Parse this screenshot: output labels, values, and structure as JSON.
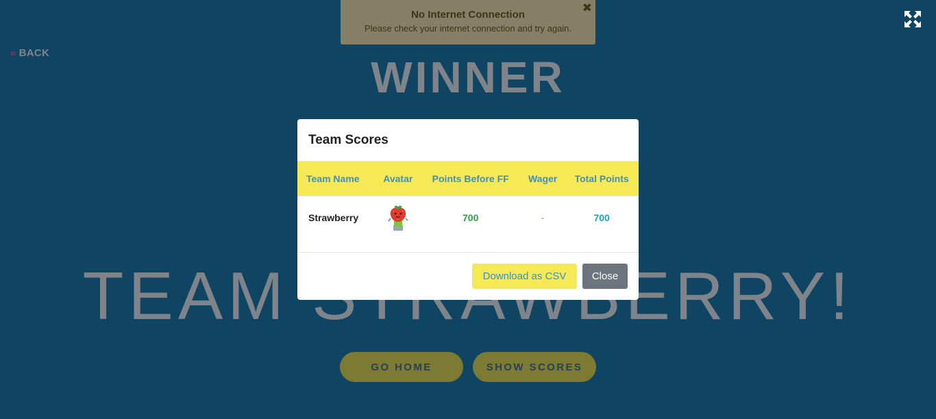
{
  "nav": {
    "back_label": "BACK"
  },
  "page": {
    "winner_heading": "WINNER",
    "team_heading": "TEAM STRAWBERRY!",
    "go_home_label": "GO HOME",
    "show_scores_label": "SHOW SCORES"
  },
  "toast": {
    "title": "No Internet Connection",
    "message": "Please check your internet connection and try again.",
    "close_glyph": "✖"
  },
  "modal": {
    "title": "Team Scores",
    "columns": [
      "Team Name",
      "Avatar",
      "Points Before FF",
      "Wager",
      "Total Points"
    ],
    "rows": [
      {
        "team_name": "Strawberry",
        "avatar": "strawberry-avatar-icon",
        "points_before_ff": "700",
        "wager": "-",
        "total_points": "700"
      }
    ],
    "download_label": "Download as CSV",
    "close_label": "Close"
  },
  "colors": {
    "background": "#0f4563",
    "accent_yellow": "#f5ea55",
    "header_text_blue": "#3d8fc8",
    "points_green": "#2e9e47",
    "total_cyan": "#1aa3c4",
    "close_gray": "#6c757d"
  }
}
